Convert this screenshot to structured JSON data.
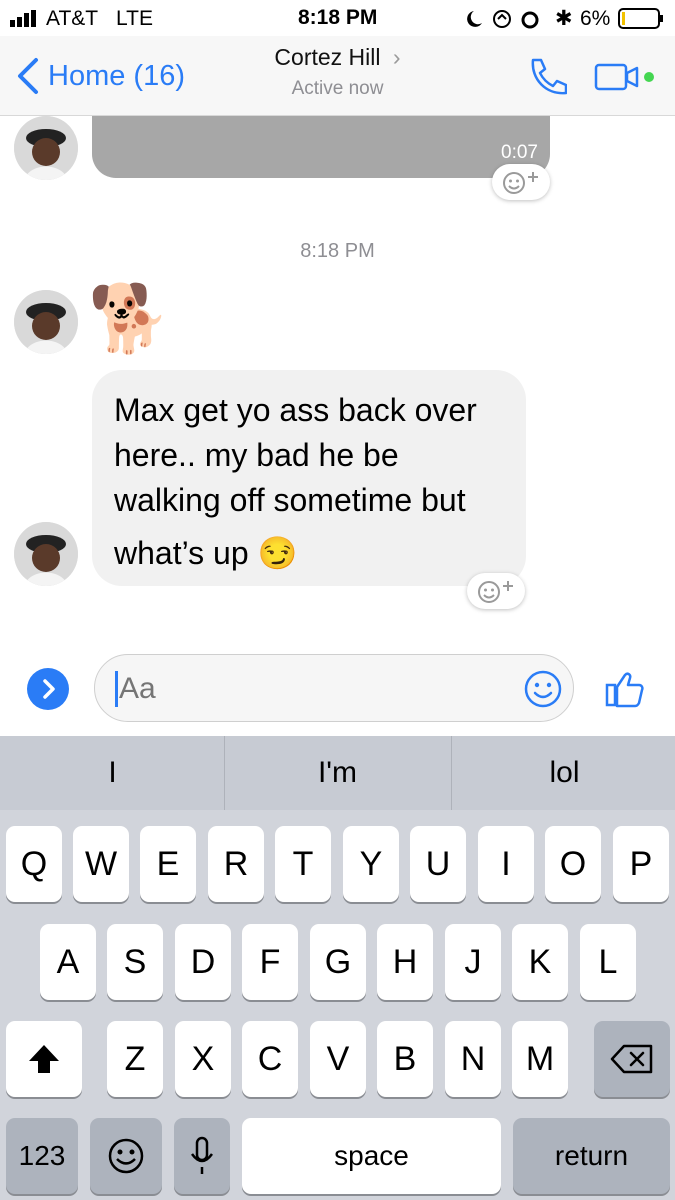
{
  "status_bar": {
    "carrier": "AT&T",
    "network": "LTE",
    "time": "8:18 PM",
    "battery": "6%"
  },
  "nav": {
    "back_label": "Home (16)",
    "contact_name": "Cortez Hill",
    "contact_status": "Active now"
  },
  "thread": {
    "audio_duration": "0:07",
    "timestamp": "8:18 PM",
    "message_lines": [
      "Max get yo ass back over",
      "here.. my bad he be",
      "walking off sometime but",
      "what’s up"
    ],
    "message_emoji": "😏",
    "sticker_emoji": "🐕"
  },
  "composer": {
    "placeholder": "Aa"
  },
  "keyboard": {
    "predictions": [
      "I",
      "I'm",
      "lol"
    ],
    "row1": [
      "Q",
      "W",
      "E",
      "R",
      "T",
      "Y",
      "U",
      "I",
      "O",
      "P"
    ],
    "row2": [
      "A",
      "S",
      "D",
      "F",
      "G",
      "H",
      "J",
      "K",
      "L"
    ],
    "row3": [
      "Z",
      "X",
      "C",
      "V",
      "B",
      "N",
      "M"
    ],
    "numbers_label": "123",
    "space_label": "space",
    "return_label": "return"
  },
  "colors": {
    "accent": "#2a7cf6",
    "active_green": "#44d651",
    "bubble": "#f1f1f1",
    "keyboard_bg": "#d1d4db"
  }
}
